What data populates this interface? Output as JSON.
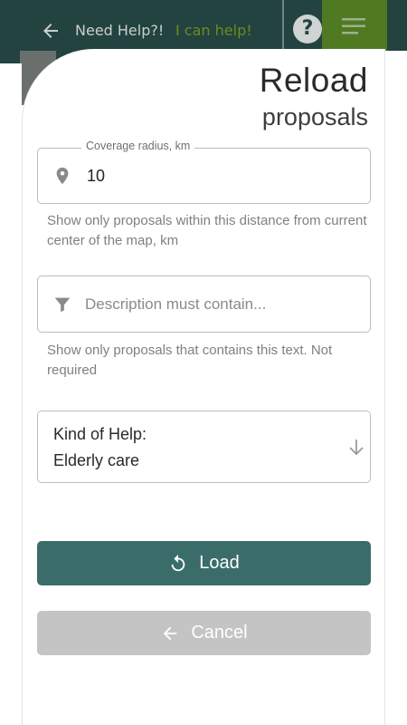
{
  "app_bar": {
    "title": "Need Help?!",
    "subtitle": "I can help!",
    "help_glyph": "?"
  },
  "dialog": {
    "title": "Reload",
    "subtitle": "proposals"
  },
  "radius_field": {
    "legend": "Coverage radius, km",
    "value": "10",
    "icon": "location-pin-icon",
    "hint": "Show only proposals within this distance from current center of the map, km"
  },
  "description_field": {
    "placeholder": "Description must contain...",
    "value": "",
    "icon": "filter-icon",
    "hint": "Show only proposals that contains this text. Not required"
  },
  "kind_field": {
    "label": "Kind of Help:",
    "value": "Elderly care",
    "icon": "arrow-down-icon"
  },
  "buttons": {
    "load_label": "Load",
    "cancel_label": "Cancel"
  },
  "colors": {
    "header": "#22433f",
    "accent": "#3a6d69",
    "subtitle_green": "#6e8a1f",
    "menu_card": "#4f7a22",
    "cancel_disabled": "#c4c4c4"
  }
}
